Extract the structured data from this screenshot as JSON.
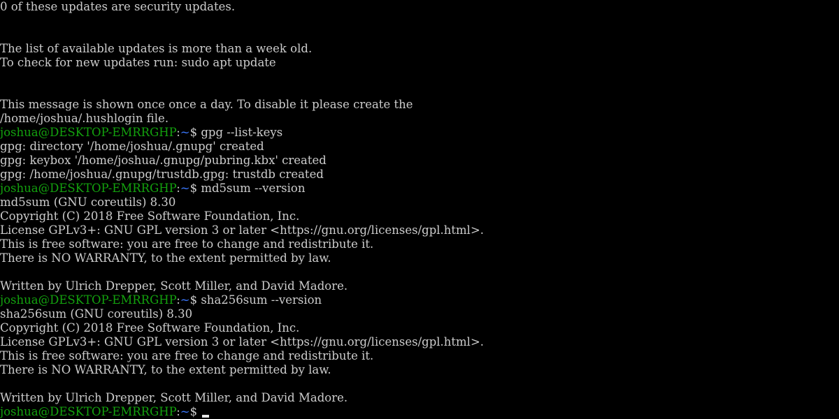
{
  "terminal": {
    "colors": {
      "background": "#000000",
      "text": "#cccccc",
      "user_host": "#13a10e",
      "path": "#3b78ff"
    },
    "lines": [
      {
        "type": "text",
        "text": "0 of these updates are security updates."
      },
      {
        "type": "blank"
      },
      {
        "type": "blank"
      },
      {
        "type": "text",
        "text": "The list of available updates is more than a week old."
      },
      {
        "type": "text",
        "text": "To check for new updates run: sudo apt update"
      },
      {
        "type": "blank"
      },
      {
        "type": "blank"
      },
      {
        "type": "text",
        "text": "This message is shown once once a day. To disable it please create the"
      },
      {
        "type": "text",
        "text": "/home/joshua/.hushlogin file."
      },
      {
        "type": "prompt",
        "user_host": "joshua@DESKTOP-EMRRGHP",
        "sep": ":",
        "path": "~",
        "sign": "$ ",
        "command": "gpg --list-keys"
      },
      {
        "type": "text",
        "text": "gpg: directory '/home/joshua/.gnupg' created"
      },
      {
        "type": "text",
        "text": "gpg: keybox '/home/joshua/.gnupg/pubring.kbx' created"
      },
      {
        "type": "text",
        "text": "gpg: /home/joshua/.gnupg/trustdb.gpg: trustdb created"
      },
      {
        "type": "prompt",
        "user_host": "joshua@DESKTOP-EMRRGHP",
        "sep": ":",
        "path": "~",
        "sign": "$ ",
        "command": "md5sum --version"
      },
      {
        "type": "text",
        "text": "md5sum (GNU coreutils) 8.30"
      },
      {
        "type": "text",
        "text": "Copyright (C) 2018 Free Software Foundation, Inc."
      },
      {
        "type": "text",
        "text": "License GPLv3+: GNU GPL version 3 or later <https://gnu.org/licenses/gpl.html>."
      },
      {
        "type": "text",
        "text": "This is free software: you are free to change and redistribute it."
      },
      {
        "type": "text",
        "text": "There is NO WARRANTY, to the extent permitted by law."
      },
      {
        "type": "blank"
      },
      {
        "type": "text",
        "text": "Written by Ulrich Drepper, Scott Miller, and David Madore."
      },
      {
        "type": "prompt",
        "user_host": "joshua@DESKTOP-EMRRGHP",
        "sep": ":",
        "path": "~",
        "sign": "$ ",
        "command": "sha256sum --version"
      },
      {
        "type": "text",
        "text": "sha256sum (GNU coreutils) 8.30"
      },
      {
        "type": "text",
        "text": "Copyright (C) 2018 Free Software Foundation, Inc."
      },
      {
        "type": "text",
        "text": "License GPLv3+: GNU GPL version 3 or later <https://gnu.org/licenses/gpl.html>."
      },
      {
        "type": "text",
        "text": "This is free software: you are free to change and redistribute it."
      },
      {
        "type": "text",
        "text": "There is NO WARRANTY, to the extent permitted by law."
      },
      {
        "type": "blank"
      },
      {
        "type": "text",
        "text": "Written by Ulrich Drepper, Scott Miller, and David Madore."
      },
      {
        "type": "prompt",
        "user_host": "joshua@DESKTOP-EMRRGHP",
        "sep": ":",
        "path": "~",
        "sign": "$ ",
        "command": "",
        "cursor": true
      }
    ]
  }
}
